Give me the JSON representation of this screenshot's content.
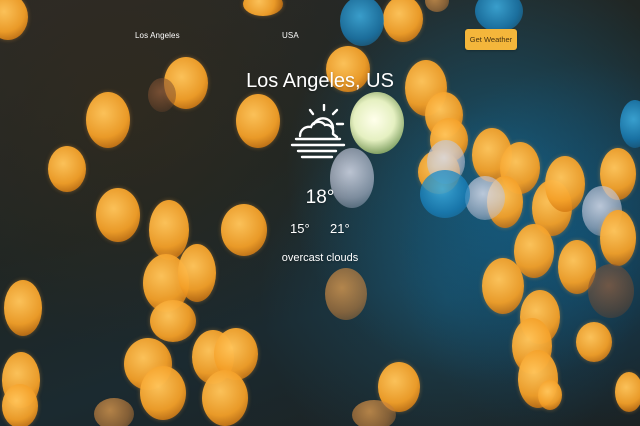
{
  "nav": {
    "city": "Los Angeles",
    "country": "USA",
    "button_label": "Get Weather"
  },
  "weather": {
    "location": "Los Angeles, US",
    "icon": "fog-sun-icon",
    "temperature": "18°",
    "temp_min": "15°",
    "temp_max": "21°",
    "description": "overcast clouds"
  },
  "colors": {
    "button": "#f4b63b",
    "text": "#ffffff"
  }
}
